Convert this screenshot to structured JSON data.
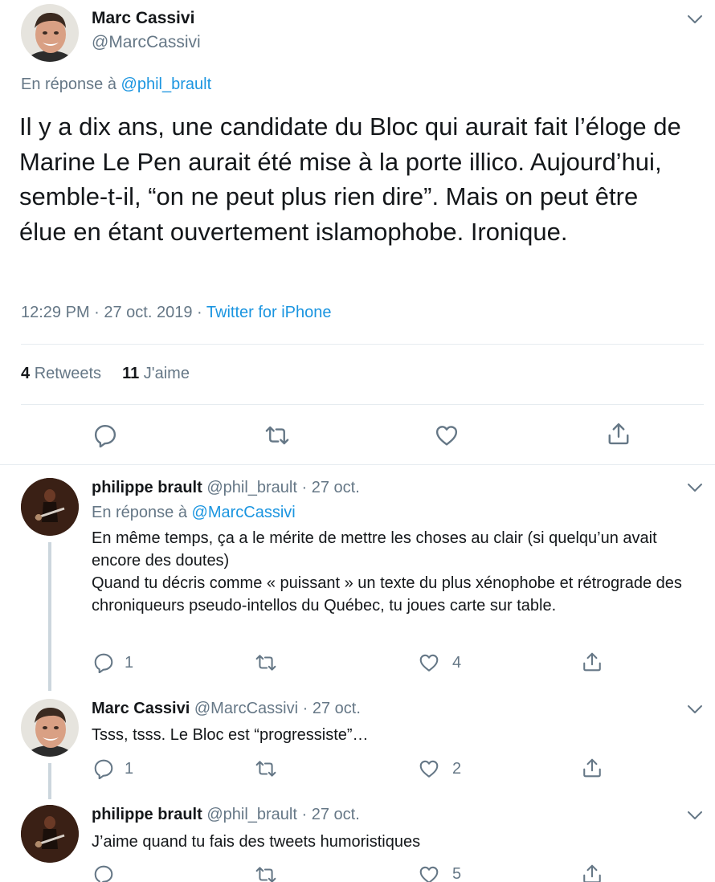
{
  "main_tweet": {
    "author_name": "Marc Cassivi",
    "author_handle": "@MarcCassivi",
    "reply_prefix": "En réponse à",
    "reply_to": "@phil_brault",
    "text": "Il y a dix ans, une candidate du Bloc qui aurait fait l’éloge de Marine Le Pen aurait été mise à la porte illico. Aujourd’hui, semble-t-il, “on ne peut plus rien dire”. Mais on peut être élue en étant ouvertement islamophobe. Ironique.",
    "time": "12:29 PM · 27 oct. 2019 ·",
    "source": "Twitter for iPhone",
    "retweets_count": "4",
    "retweets_label": "Retweets",
    "likes_count": "11",
    "likes_label": "J'aime"
  },
  "replies": [
    {
      "author_name": "philippe brault",
      "meta": "@phil_brault · 27 oct.",
      "reply_prefix": "En réponse à",
      "reply_to": "@MarcCassivi",
      "text_line1": "En même temps, ça a le mérite de mettre les choses au clair (si quelqu’un avait encore des doutes)",
      "text_line2": "Quand tu décris comme « puissant » un texte du plus xénophobe et rétrograde des chroniqueurs pseudo-intellos du Québec, tu joues carte sur table.",
      "reply_count": "1",
      "like_count": "4"
    },
    {
      "author_name": "Marc Cassivi",
      "meta": "@MarcCassivi · 27 oct.",
      "text": "Tsss, tsss. Le Bloc est “progressiste”…",
      "reply_count": "1",
      "like_count": "2"
    },
    {
      "author_name": "philippe brault",
      "meta": "@phil_brault · 27 oct.",
      "text": "J’aime quand tu fais des tweets humoristiques",
      "like_count": "5"
    }
  ],
  "colors": {
    "text": "#14171a",
    "muted": "#657786",
    "link": "#1b95e0",
    "divider": "#e6ecf0"
  },
  "icons": [
    "chevron-down-icon",
    "reply-icon",
    "retweet-icon",
    "like-icon",
    "share-icon"
  ]
}
